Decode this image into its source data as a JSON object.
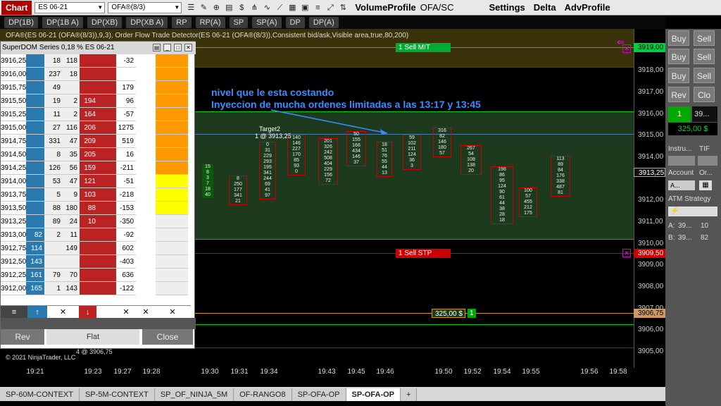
{
  "toolbar": {
    "chart": "Chart",
    "instrument": "ES 06-21",
    "series": "OFA®(8/3)",
    "volume_profile": "VolumeProfile",
    "ofa_sc": "OFA/SC",
    "settings": "Settings",
    "delta": "Delta",
    "adv_profile": "AdvProfile"
  },
  "indicators": [
    "DP(1B)",
    "DP(1B A)",
    "DP(XB)",
    "DP(XB A)",
    "RP",
    "RP(A)",
    "SP",
    "SP(A)",
    "DP",
    "DP(A)"
  ],
  "chart": {
    "header": "OFA®(ES 06-21 (OFA®(8/3)),9,3), Order Flow Trade Detector(ES 06-21 (OFA®(8/3)),Consistent bid/ask,Visible area,true,80,200)",
    "note_line1": "nivel que le esta costando",
    "note_line2": "Inyeccion de mucha ordenes limitadas a las 13:17 y  13:45",
    "target_label": "Target2",
    "target_value": "1 @ 3913,25",
    "sell_mit": "1  Sell MIT",
    "sell_stp": "1  Sell STP",
    "pnl": "325,00 $",
    "pnl_qty": "1",
    "bottom_marker": "4 @ 3906,75",
    "copyright": "© 2021 NinjaTrader, LLC",
    "price_levels": [
      "3919,00",
      "3918,00",
      "3917,00",
      "3916,00",
      "3915,00",
      "3914,00",
      "3913,25",
      "3912,00",
      "3911,00",
      "3910,00",
      "3909,50",
      "3909,00",
      "3908,00",
      "3907,00",
      "3906,75",
      "3906,00",
      "3905,00"
    ],
    "times": [
      "19:21",
      "19:23",
      "19:27",
      "19:28",
      "19:30",
      "19:31",
      "19:34",
      "19:43",
      "19:45",
      "19:46",
      "19:50",
      "19:52",
      "19:54",
      "19:55",
      "19:56",
      "19:58"
    ]
  },
  "superdom": {
    "title": "SuperDOM Series 0,18 % ES 06-21",
    "prices": [
      "3916,25",
      "3916,00",
      "3915,75",
      "3915,50",
      "3915,25",
      "3915,00",
      "3914,75",
      "3914,50",
      "3914,25",
      "3914,00",
      "3913,75",
      "3913,50",
      "3913,25",
      "3913,00",
      "3912,75",
      "3912,50",
      "3912,25",
      "3912,00"
    ],
    "bid": [
      "",
      "",
      "",
      "",
      "",
      "",
      "",
      "",
      "",
      "",
      "",
      "",
      "",
      "82",
      "114",
      "143",
      "161",
      "165"
    ],
    "col_a": [
      "18",
      "237",
      "49",
      "19",
      "11",
      "27",
      "331",
      "8",
      "126",
      "53",
      "5",
      "88",
      "89",
      "2",
      "",
      "",
      "79",
      "1"
    ],
    "col_b": [
      "118",
      "18",
      "",
      "2",
      "2",
      "116",
      "47",
      "35",
      "56",
      "47",
      "9",
      "180",
      "24",
      "11",
      "149",
      "",
      "70",
      "143"
    ],
    "ask": [
      "",
      "",
      "",
      "194",
      "164",
      "206",
      "209",
      "205",
      "159",
      "121",
      "103",
      "88",
      "10",
      "",
      "",
      "",
      "",
      ""
    ],
    "delta": [
      "-32",
      "",
      "179",
      "96",
      "-57",
      "1275",
      "519",
      "16",
      "-211",
      "-51",
      "-218",
      "-153",
      "-350",
      "-92",
      "602",
      "-403",
      "636",
      "-122"
    ],
    "rev": "Rev",
    "flat": "Flat",
    "close": "Close"
  },
  "rpanel": {
    "buy": "Buy",
    "sell": "Sell",
    "rev": "Rev",
    "close": "Clo",
    "qty": "1",
    "qty_price": "39...",
    "pnl": "325,00 $",
    "instrument": "Instru...",
    "tif": "TIF",
    "account": "Account",
    "order": "Or...",
    "acc_val": "A...",
    "atm": "ATM Strategy",
    "a_label": "A:",
    "a_price": "39...",
    "a_qty": "10",
    "b_label": "B:",
    "b_price": "39...",
    "b_qty": "82"
  },
  "tabs": [
    "SP-60M-CONTEXT",
    "SP-5M-CONTEXT",
    "SP_OF_NINJA_5M",
    "OF-RANGO8",
    "SP-OFA-OP",
    "SP-OFA-OP",
    "+"
  ],
  "colors": {
    "green": "#00cc00",
    "red": "#cc0000",
    "blue": "#3c8cff",
    "accent": "#b00000"
  }
}
